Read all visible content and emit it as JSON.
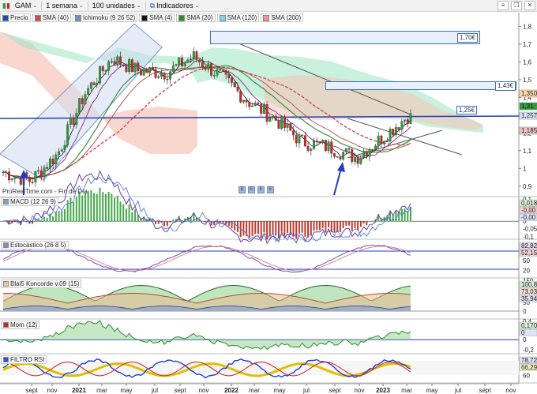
{
  "toolbar": {
    "symbol": "GAM",
    "timeframe": "1 semana",
    "units": "100 unidades",
    "indicators": "Indicadores"
  },
  "legend": [
    {
      "label": "Precio",
      "color": "#1f4e9a"
    },
    {
      "label": "SMA (40)",
      "color": "#d24a4a"
    },
    {
      "label": "Ichimoku (9 26 52)",
      "color": "#6f8fc7"
    },
    {
      "label": "SMA (4)",
      "color": "#111111"
    },
    {
      "label": "SMA (20)",
      "color": "#2e8b2e"
    },
    {
      "label": "SMA (120)",
      "color": "#7ad7e8"
    },
    {
      "label": "SMA (200)",
      "color": "#e89595"
    }
  ],
  "watermark": "ProRealTime.com - Fin de Día",
  "annotations": {
    "level_170": "1,70€",
    "level_143": "1,43€",
    "level_125": "1,25€"
  },
  "panels": {
    "macd": "MACD (12 26 9)",
    "stoch": "Estocástico (26 8 5)",
    "blai5": "Blai5 Koncorde v.09 (15)",
    "mom": "Mom (12)",
    "rsi": "FILTRO RSI"
  },
  "price_axis_ticks": [
    "1,8",
    "1,7",
    "1,6",
    "1,5",
    "1,4",
    "1,3",
    "1,2",
    "1,1",
    "1",
    "0,9"
  ],
  "price_tags": [
    {
      "text": "1,350",
      "color": "#ffd9a8"
    },
    {
      "text": "1,31",
      "color": "#2e9a3a"
    },
    {
      "text": "1,257",
      "color": "#d7e6f6"
    },
    {
      "text": "1,185",
      "color": "#f3c5c5"
    }
  ],
  "macd_axis": [
    "0,1",
    "0,05",
    "0",
    "-0,05",
    "-0,1"
  ],
  "macd_tags": [
    "0,018",
    "-0,00",
    "-0,00"
  ],
  "stoch_axis": [
    "80",
    "50",
    "20"
  ],
  "stoch_tags": [
    "82,82",
    "52,15"
  ],
  "blai5_axis": [
    "150",
    "100",
    "50",
    "0"
  ],
  "blai5_tags": [
    "100,8",
    "73,03",
    "35,94"
  ],
  "mom_axis": [
    "0,4",
    "0,2",
    "0",
    "-0,2"
  ],
  "mom_tags": [
    "0,170",
    "0"
  ],
  "rsi_axis": [
    "80",
    "60"
  ],
  "rsi_tags": [
    "78,72",
    "66,29"
  ],
  "x_axis": [
    "sept",
    "nov",
    "2021",
    "mar",
    "may",
    "jul",
    "sept",
    "nov",
    "2022",
    "mar",
    "may",
    "jul",
    "sept",
    "nov",
    "2023",
    "mar",
    "may",
    "jul",
    "sept",
    "nov"
  ],
  "colors": {
    "up": "#2e9a3a",
    "down": "#c62828",
    "accent": "#1f3fbf"
  },
  "chart_data": {
    "type": "line",
    "title": "GAM",
    "ylabel": "",
    "ylim": [
      0.85,
      1.82
    ],
    "x": [
      "2020-08",
      "2020-10",
      "2020-12",
      "2021-02",
      "2021-04",
      "2021-06",
      "2021-08",
      "2021-10",
      "2021-12",
      "2022-02",
      "2022-04",
      "2022-06",
      "2022-08",
      "2022-10",
      "2022-12",
      "2023-02"
    ],
    "series": [
      {
        "name": "Precio",
        "values": [
          0.98,
          0.93,
          1.08,
          1.42,
          1.62,
          1.55,
          1.54,
          1.63,
          1.52,
          1.38,
          1.28,
          1.15,
          1.12,
          1.06,
          1.18,
          1.31
        ]
      }
    ]
  }
}
